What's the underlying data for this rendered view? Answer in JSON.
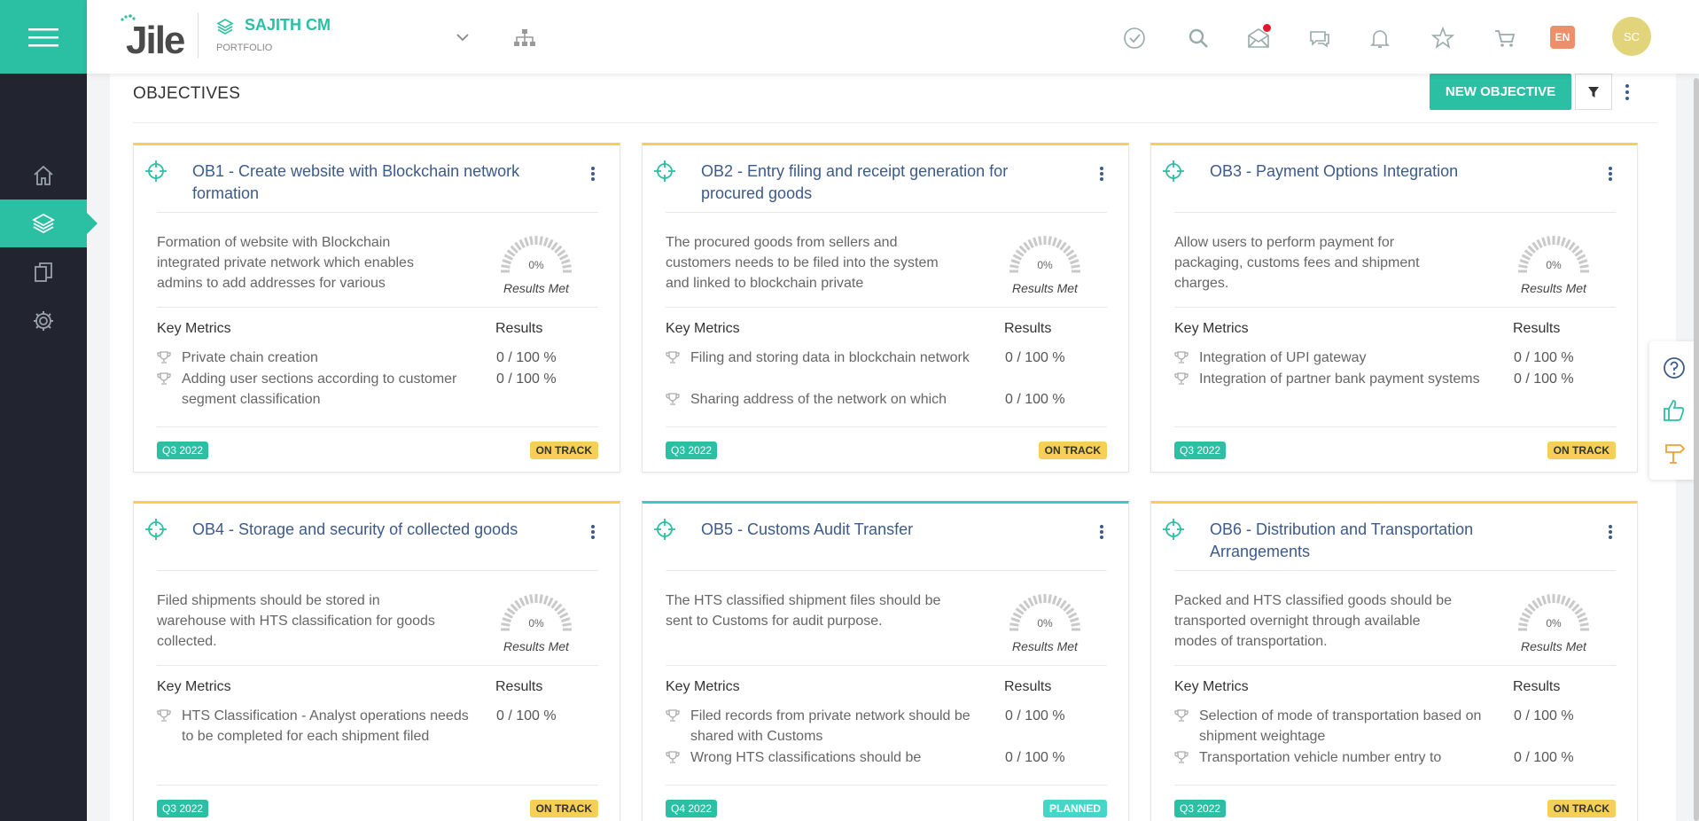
{
  "header": {
    "logo_text": "Jile",
    "portfolio_name": "SAJITH CM",
    "portfolio_label": "PORTFOLIO",
    "language": "EN",
    "user_initials": "SC"
  },
  "page": {
    "title": "OBJECTIVES",
    "new_button": "NEW OBJECTIVE"
  },
  "objectives": [
    {
      "title": "OB1 - Create website with Blockchain network formation",
      "description": "Formation of website with Blockchain integrated private network which enables admins to add addresses for various",
      "progress_pct": "0%",
      "results_label": "Results Met",
      "key_metrics_label": "Key Metrics",
      "results_header": "Results",
      "metrics": [
        {
          "name": "Private chain creation",
          "result": "0 / 100 %"
        },
        {
          "name": "Adding user sections according to customer segment classification",
          "result": "0 / 100 %"
        }
      ],
      "quarter": "Q3 2022",
      "status": "ON TRACK"
    },
    {
      "title": "OB2 - Entry filing and receipt generation for procured goods",
      "description": "The procured goods from sellers and customers needs to be filed into the system and linked to blockchain private",
      "progress_pct": "0%",
      "results_label": "Results Met",
      "key_metrics_label": "Key Metrics",
      "results_header": "Results",
      "metrics": [
        {
          "name": "Filing and storing data in blockchain network",
          "result": "0 / 100 %"
        },
        {
          "name": "Sharing address of the network on which",
          "result": "0 / 100 %"
        }
      ],
      "quarter": "Q3 2022",
      "status": "ON TRACK"
    },
    {
      "title": "OB3 - Payment Options Integration",
      "description": "Allow users to perform payment for packaging, customs fees and shipment charges.",
      "progress_pct": "0%",
      "results_label": "Results Met",
      "key_metrics_label": "Key Metrics",
      "results_header": "Results",
      "metrics": [
        {
          "name": "Integration of UPI gateway",
          "result": "0 / 100 %"
        },
        {
          "name": "Integration of partner bank payment systems",
          "result": "0 / 100 %"
        }
      ],
      "quarter": "Q3 2022",
      "status": "ON TRACK"
    },
    {
      "title": "OB4 - Storage and security of collected goods",
      "description": "Filed shipments should be stored in warehouse with HTS classification for goods collected.",
      "progress_pct": "0%",
      "results_label": "Results Met",
      "key_metrics_label": "Key Metrics",
      "results_header": "Results",
      "metrics": [
        {
          "name": "HTS Classification - Analyst operations needs to be completed for each shipment filed",
          "result": "0 / 100 %"
        }
      ],
      "quarter": "Q3 2022",
      "status": "ON TRACK"
    },
    {
      "title": "OB5 - Customs Audit Transfer",
      "description": "The HTS classified shipment files should be sent to Customs for audit purpose.",
      "progress_pct": "0%",
      "results_label": "Results Met",
      "key_metrics_label": "Key Metrics",
      "results_header": "Results",
      "metrics": [
        {
          "name": "Filed records from private network should be shared with Customs",
          "result": "0 / 100 %"
        },
        {
          "name": "Wrong HTS classifications should be",
          "result": "0 / 100 %"
        }
      ],
      "quarter": "Q4 2022",
      "status": "PLANNED"
    },
    {
      "title": "OB6 - Distribution and Transportation Arrangements",
      "description": "Packed and HTS classified goods should be transported overnight through available modes of transportation.",
      "progress_pct": "0%",
      "results_label": "Results Met",
      "key_metrics_label": "Key Metrics",
      "results_header": "Results",
      "metrics": [
        {
          "name": "Selection of mode of transportation based on shipment weightage",
          "result": "0 / 100 %"
        },
        {
          "name": "Transportation vehicle number entry to",
          "result": "0 / 100 %"
        }
      ],
      "quarter": "Q3 2022",
      "status": "ON TRACK"
    }
  ],
  "colors": {
    "accent": "#2bbfa4",
    "sidebar": "#222530",
    "title_blue": "#3c5a8c",
    "on_track": "#f6cf57",
    "planned": "#43d6c9"
  }
}
